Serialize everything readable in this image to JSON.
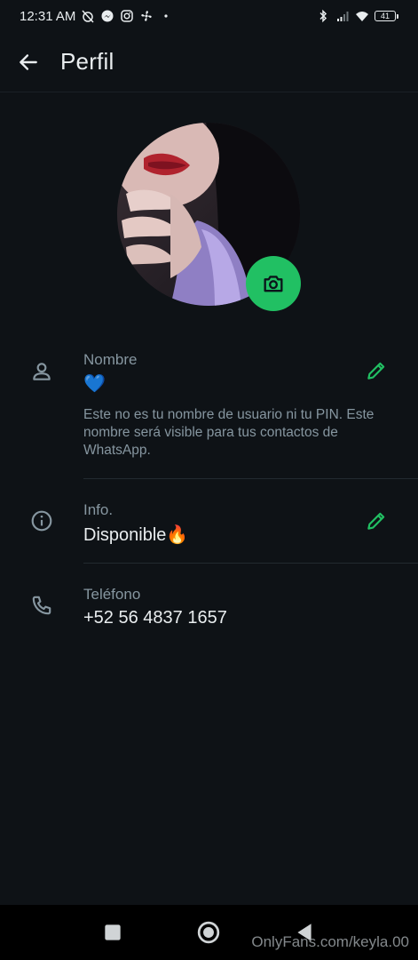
{
  "status_bar": {
    "time": "12:31 AM",
    "battery": "41"
  },
  "header": {
    "title": "Perfil"
  },
  "name_row": {
    "label": "Nombre",
    "value": "💙",
    "note": "Este no es tu nombre de usuario ni tu PIN. Este nombre será visible para tus contactos de WhatsApp."
  },
  "info_row": {
    "label": "Info.",
    "value": "Disponible🔥"
  },
  "phone_row": {
    "label": "Teléfono",
    "value": "+52 56 4837 1657"
  },
  "watermark": "OnlyFans.com/keyla.00",
  "colors": {
    "accent": "#21c063",
    "background": "#0e1216",
    "primary_text": "#e9edef",
    "secondary_text": "#8696a0"
  },
  "icons": {
    "back": "arrow-left-icon",
    "camera": "camera-icon",
    "name": "person-icon",
    "info": "info-icon",
    "phone": "phone-icon",
    "edit": "pencil-icon"
  }
}
